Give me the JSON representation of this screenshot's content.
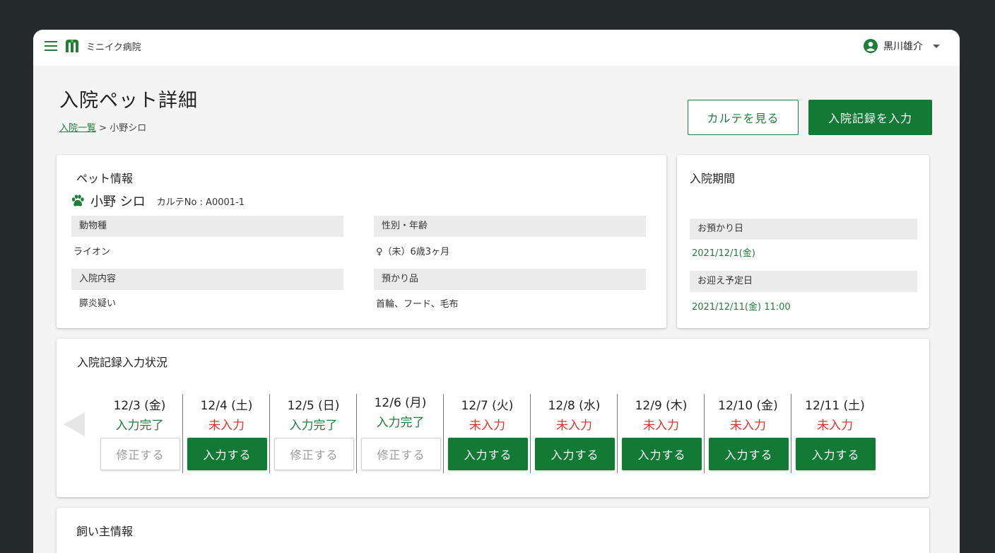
{
  "colors": {
    "accent": "#137a35",
    "done": "#1e7e3a",
    "todo": "#d9342b"
  },
  "header": {
    "app_name": "ミニイク病院",
    "user_name": "黒川雄介"
  },
  "page": {
    "title": "入院ペット詳細",
    "breadcrumb_link": "入院一覧",
    "breadcrumb_sep": " > ",
    "breadcrumb_current": "小野シロ",
    "btn_karte": "カルテを見る",
    "btn_record": "入院記録を入力"
  },
  "pet": {
    "section_title": "ペット情報",
    "name": "小野 シロ",
    "karte_no": "カルテNo : A0001-1",
    "species_label": "動物種",
    "species_value": "ライオン",
    "sex_age_label": "性別・年齢",
    "sex_age_value": "♀（未）6歳3ヶ月",
    "reason_label": "入院内容",
    "reason_value": "膵炎疑い",
    "items_label": "預かり品",
    "items_value": "首輪、フード、毛布"
  },
  "period": {
    "section_title": "入院期間",
    "admit_label": "お預かり日",
    "admit_value": "2021/12/1(金)",
    "pickup_label": "お迎え予定日",
    "pickup_value": "2021/12/11(金) 11:00"
  },
  "records": {
    "section_title": "入院記録入力状況",
    "days": [
      {
        "date": "12/3 (金)",
        "status": "入力完了",
        "button": "修正する"
      },
      {
        "date": "12/4 (土)",
        "status": "未入力",
        "button": "入力する"
      },
      {
        "date": "12/5 (日)",
        "status": "入力完了",
        "button": "修正する"
      },
      {
        "date": "12/6 (月)",
        "status": "入力完了",
        "button": "修正する"
      },
      {
        "date": "12/7 (火)",
        "status": "未入力",
        "button": "入力する"
      },
      {
        "date": "12/8 (水)",
        "status": "未入力",
        "button": "入力する"
      },
      {
        "date": "12/9 (木)",
        "status": "未入力",
        "button": "入力する"
      },
      {
        "date": "12/10 (金)",
        "status": "未入力",
        "button": "入力する"
      },
      {
        "date": "12/11 (土)",
        "status": "未入力",
        "button": "入力する"
      }
    ]
  },
  "owner": {
    "section_title": "飼い主情報"
  }
}
